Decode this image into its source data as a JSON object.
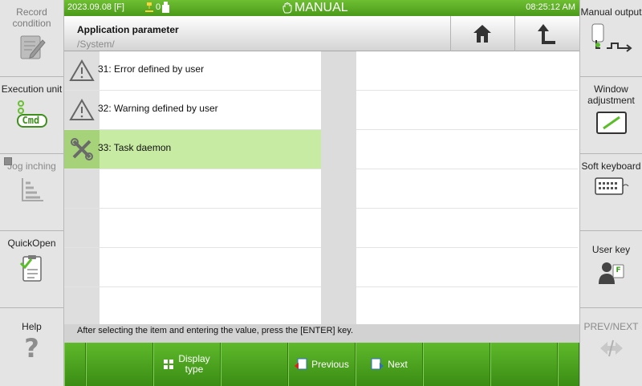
{
  "topbar": {
    "date": "2023.09.08 [F]",
    "io_count": "0",
    "mode": "MANUAL",
    "time": "08:25:12 AM"
  },
  "left_panel": {
    "record_condition": "Record condition",
    "execution_unit": "Execution unit",
    "jog_inching": "Jog inching",
    "quickopen": "QuickOpen",
    "help": "Help",
    "cmd_icon_text": "Cmd"
  },
  "right_panel": {
    "manual_output": "Manual output",
    "window_adjustment": "Window adjustment",
    "soft_keyboard": "Soft keyboard",
    "user_key": "User key",
    "prev_next": "PREV/NEXT",
    "user_key_badge": "F"
  },
  "header": {
    "title": "Application parameter",
    "path": "/System/"
  },
  "list": {
    "rows": [
      {
        "label": "31: Error defined by user",
        "icon": "warning-triangle-icon"
      },
      {
        "label": "32: Warning defined by user",
        "icon": "warning-triangle-icon"
      },
      {
        "label": "33: Task daemon",
        "icon": "wrench-cross-icon",
        "selected": true
      }
    ]
  },
  "message": "After selecting the item and entering the value, press the [ENTER] key.",
  "bottom": {
    "display_type_line1": "Display",
    "display_type_line2": "type",
    "previous": "Previous",
    "next": "Next"
  },
  "colors": {
    "accent_green": "#4a9a1a",
    "selected_row": "#c8eba3"
  }
}
